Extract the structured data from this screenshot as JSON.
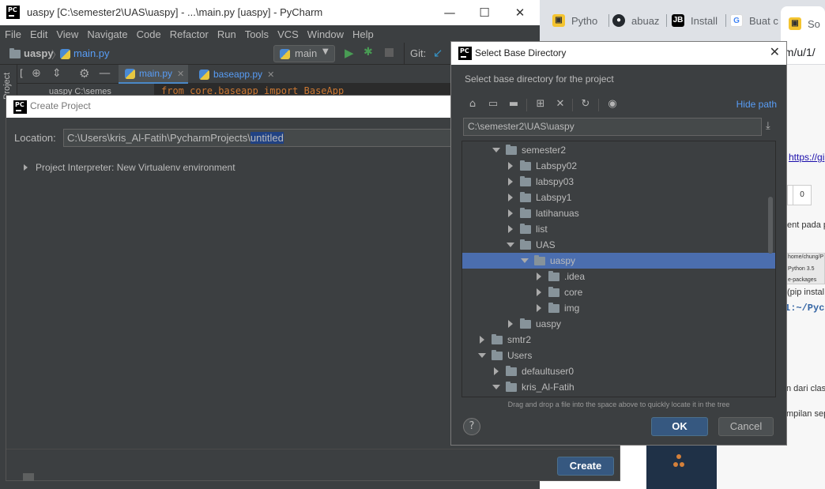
{
  "browser": {
    "tabs": [
      "Pytho",
      "abuaz",
      "Install",
      "Buat c",
      "So"
    ],
    "url_fragment": "om/u/1/",
    "page": {
      "link": "https://gi",
      "field_value": "0",
      "text1": "ent pada p",
      "path_snippet": "home/chung/P",
      "python_snippet": "Python 3.5",
      "packages": "e-packages",
      "pip": "(pip instal",
      "term": "1:~/Pych",
      "line1": "n dari class",
      "line2": "mpilan sepe"
    }
  },
  "pycharm": {
    "window_title": "uaspy [C:\\semester2\\UAS\\uaspy] - ...\\main.py [uaspy] - PyCharm",
    "menu": [
      "File",
      "Edit",
      "View",
      "Navigate",
      "Code",
      "Refactor",
      "Run",
      "Tools",
      "VCS",
      "Window",
      "Help"
    ],
    "breadcrumb": [
      "uaspy",
      "main.py"
    ],
    "run_config": "main",
    "git_label": "Git:",
    "side_label": "Project",
    "project_header": "uaspy C:\\semes",
    "tabs": [
      "main.py",
      "baseapp.py"
    ],
    "code_line": "from core.baseapp import BaseApp"
  },
  "create_dialog": {
    "title": "Create Project",
    "location_label": "Location:",
    "location_prefix": "C:\\Users\\kris_Al-Fatih\\PycharmProjects\\",
    "location_selected": "untitled",
    "interpreter": "Project Interpreter: New Virtualenv environment",
    "create_button": "Create"
  },
  "select_dialog": {
    "title": "Select Base Directory",
    "hint": "Select base directory for the project",
    "hide_path": "Hide path",
    "path": "C:\\semester2\\UAS\\uaspy",
    "tree": [
      {
        "name": "semester2",
        "depth": 1,
        "state": "expanded"
      },
      {
        "name": "Labspy02",
        "depth": 2,
        "state": "collapsed"
      },
      {
        "name": "labspy03",
        "depth": 2,
        "state": "collapsed"
      },
      {
        "name": "Labspy1",
        "depth": 2,
        "state": "collapsed"
      },
      {
        "name": "latihanuas",
        "depth": 2,
        "state": "collapsed"
      },
      {
        "name": "list",
        "depth": 2,
        "state": "collapsed"
      },
      {
        "name": "UAS",
        "depth": 2,
        "state": "expanded"
      },
      {
        "name": "uaspy",
        "depth": 3,
        "state": "expanded",
        "selected": true
      },
      {
        "name": ".idea",
        "depth": 4,
        "state": "collapsed"
      },
      {
        "name": "core",
        "depth": 4,
        "state": "collapsed"
      },
      {
        "name": "img",
        "depth": 4,
        "state": "collapsed"
      },
      {
        "name": "uaspy",
        "depth": 2,
        "state": "collapsed"
      },
      {
        "name": "smtr2",
        "depth": 0,
        "state": "collapsed"
      },
      {
        "name": "Users",
        "depth": 0,
        "state": "expanded"
      },
      {
        "name": "defaultuser0",
        "depth": 1,
        "state": "collapsed"
      },
      {
        "name": "kris_Al-Fatih",
        "depth": 1,
        "state": "expanded"
      }
    ],
    "dnd_hint": "Drag and drop a file into the space above to quickly locate it in the tree",
    "ok_button": "OK",
    "cancel_button": "Cancel",
    "help": "?"
  },
  "colors": {
    "selection": "#4b6eaf",
    "primary_button": "#365880",
    "link": "#589df6",
    "run": "#499c54"
  }
}
